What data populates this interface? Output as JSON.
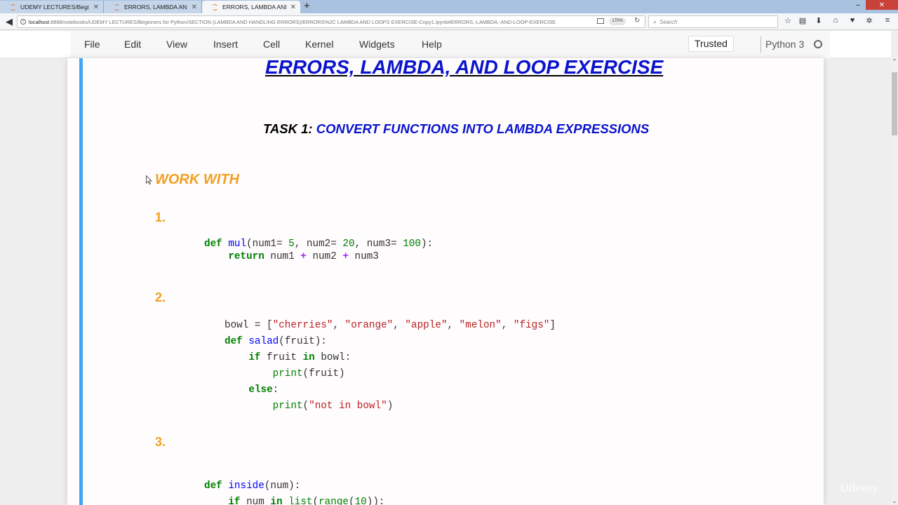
{
  "browser": {
    "tabs": [
      {
        "label": "UDEMY LECTURES/Beginner",
        "active": false
      },
      {
        "label": "ERRORS, LAMBDA AND LOO",
        "active": false
      },
      {
        "label": "ERRORS, LAMBDA AND LOO",
        "active": true
      }
    ],
    "new_tab": "+",
    "window_controls": {
      "minimize": "–",
      "maximize": "❐",
      "close": "✕"
    },
    "url": {
      "host": "localhost",
      "rest": ":8888/notebooks/UDEMY LECTURES/Beginners for Python/SECTION (LAMBDA AND HANDLING ERRORS)/ERRORS%2C LAMBDA AND LOOPS EXERCISE-Copy1.ipynb#ERRORS,-LAMBDA,-AND-LOOP-EXERCISE"
    },
    "zoom": "170%",
    "search_placeholder": "Search",
    "toolbar_icons": [
      "bookmark-star",
      "clipboard",
      "download",
      "home",
      "pocket",
      "extension",
      "menu"
    ]
  },
  "jupyter": {
    "menu": [
      "File",
      "Edit",
      "View",
      "Insert",
      "Cell",
      "Kernel",
      "Widgets",
      "Help"
    ],
    "trusted": "Trusted",
    "kernel": "Python 3"
  },
  "notebook": {
    "title": "ERRORS, LAMBDA, AND LOOP EXERCISE",
    "task_label": "TASK 1:",
    "task_desc": "CONVERT FUNCTIONS INTO LAMBDA EXPRESSIONS",
    "work_with": "WORK WITH",
    "numbers": [
      "1.",
      "2.",
      "3."
    ],
    "code1": [
      "def mul(num1= 5, num2= 20, num3= 100):",
      "    return num1 + num2 + num3"
    ],
    "code2": [
      "bowl = [\"cherries\", \"orange\", \"apple\", \"melon\", \"figs\"]",
      "def salad(fruit):",
      "    if fruit in bowl:",
      "        print(fruit)",
      "    else:",
      "        print(\"not in bowl\")"
    ],
    "code3": [
      "def inside(num):",
      "    if num in list(range(10)):"
    ]
  },
  "watermark": "Udemy"
}
